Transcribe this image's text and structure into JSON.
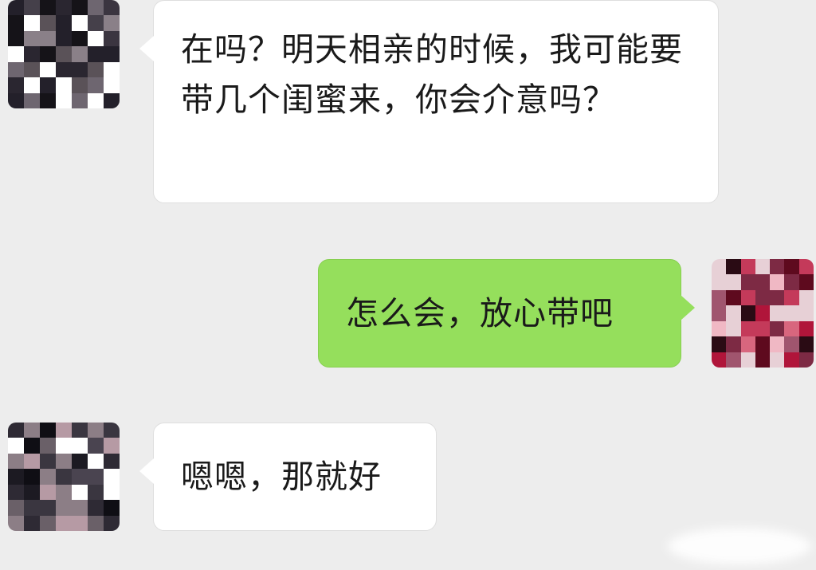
{
  "colors": {
    "background": "#ededed",
    "incoming_bubble": "#ffffff",
    "outgoing_bubble": "#95df5c",
    "text": "#1a1a1a"
  },
  "messages": [
    {
      "direction": "incoming",
      "avatar": "pixelated-avatar-dark",
      "text": "在吗？明天相亲的时候，我可能要带几个闺蜜来，你会介意吗？"
    },
    {
      "direction": "outgoing",
      "avatar": "pixelated-avatar-red",
      "text": "怎么会，放心带吧"
    },
    {
      "direction": "incoming",
      "avatar": "pixelated-avatar-dark",
      "text": "嗯嗯，那就好"
    }
  ]
}
